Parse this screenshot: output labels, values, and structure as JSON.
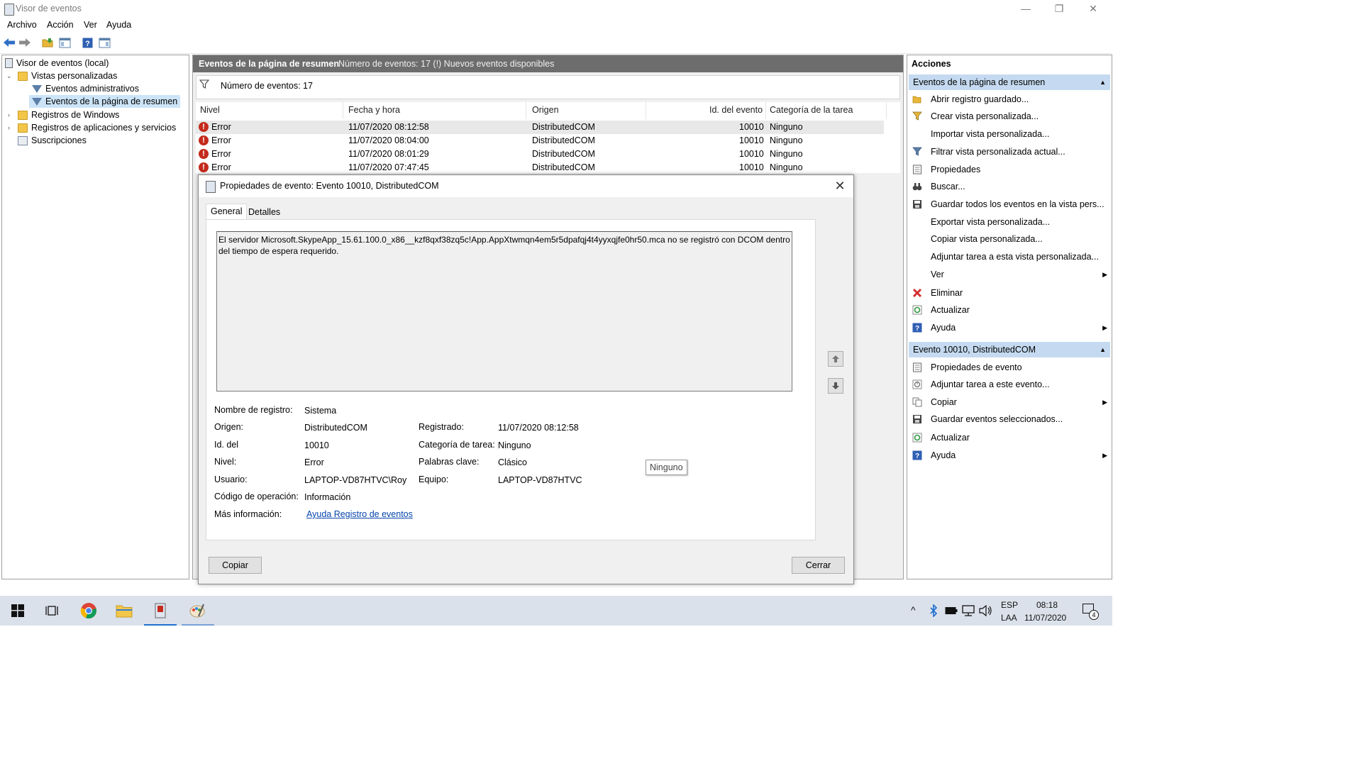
{
  "window": {
    "title": "Visor de eventos",
    "controls": {
      "minimize": "—",
      "restore": "❐",
      "close": "✕"
    }
  },
  "menu": [
    "Archivo",
    "Acción",
    "Ver",
    "Ayuda"
  ],
  "tree": {
    "items": [
      {
        "label": "Visor de eventos (local)"
      },
      {
        "label": "Vistas personalizadas"
      },
      {
        "label": "Eventos administrativos"
      },
      {
        "label": "Eventos de la página de resumen"
      },
      {
        "label": "Registros de Windows"
      },
      {
        "label": "Registros de aplicaciones y servicios"
      },
      {
        "label": "Suscripciones"
      }
    ]
  },
  "center": {
    "header_title": "Eventos de la página de resumen",
    "header_info": "Número de eventos: 17 (!) Nuevos eventos disponibles",
    "filter_text": "Número de eventos: 17",
    "columns": [
      "Nivel",
      "Fecha y hora",
      "Origen",
      "Id. del evento",
      "Categoría de la tarea"
    ],
    "rows": [
      {
        "level": "Error",
        "datetime": "11/07/2020 08:12:58",
        "source": "DistributedCOM",
        "id": "10010",
        "category": "Ninguno"
      },
      {
        "level": "Error",
        "datetime": "11/07/2020 08:04:00",
        "source": "DistributedCOM",
        "id": "10010",
        "category": "Ninguno"
      },
      {
        "level": "Error",
        "datetime": "11/07/2020 08:01:29",
        "source": "DistributedCOM",
        "id": "10010",
        "category": "Ninguno"
      },
      {
        "level": "Error",
        "datetime": "11/07/2020 07:47:45",
        "source": "DistributedCOM",
        "id": "10010",
        "category": "Ninguno"
      }
    ]
  },
  "dialog": {
    "title": "Propiedades de evento: Evento 10010, DistributedCOM",
    "tabs": [
      "General",
      "Detalles"
    ],
    "description": "El servidor Microsoft.SkypeApp_15.61.100.0_x86__kzf8qxf38zq5c!App.AppXtwmqn4em5r5dpafqj4t4yyxqjfe0hr50.mca no se registró con DCOM dentro del tiempo de espera requerido.",
    "fields": {
      "log_name_label": "Nombre de registro:",
      "log_name": "Sistema",
      "source_label": "Origen:",
      "source": "DistributedCOM",
      "logged_label": "Registrado:",
      "logged": "11/07/2020 08:12:58",
      "event_id_label": "Id. del",
      "event_id": "10010",
      "task_cat_label": "Categoría de tarea:",
      "task_cat": "Ninguno",
      "level_label": "Nivel:",
      "level": "Error",
      "keywords_label": "Palabras clave:",
      "keywords": "Clásico",
      "user_label": "Usuario:",
      "user": "LAPTOP-VD87HTVC\\Roy",
      "computer_label": "Equipo:",
      "computer": "LAPTOP-VD87HTVC",
      "opcode_label": "Código de operación:",
      "opcode": "Información",
      "more_info_label": "Más información:",
      "more_info_link": "Ayuda Registro de eventos"
    },
    "tooltip": "Ninguno",
    "copy_button": "Copiar",
    "close_button": "Cerrar"
  },
  "actions": {
    "title": "Acciones",
    "section1": {
      "title": "Eventos de la página de resumen",
      "items": [
        {
          "label": "Abrir registro guardado...",
          "icon": "folder-open-icon"
        },
        {
          "label": "Crear vista personalizada...",
          "icon": "filter-create-icon"
        },
        {
          "label": "Importar vista personalizada...",
          "icon": ""
        },
        {
          "label": "Filtrar vista personalizada actual...",
          "icon": "filter-icon"
        },
        {
          "label": "Propiedades",
          "icon": "properties-icon"
        },
        {
          "label": "Buscar...",
          "icon": "binoculars-icon"
        },
        {
          "label": "Guardar todos los eventos en la vista pers...",
          "icon": "save-icon"
        },
        {
          "label": "Exportar vista personalizada...",
          "icon": ""
        },
        {
          "label": "Copiar vista personalizada...",
          "icon": ""
        },
        {
          "label": "Adjuntar tarea a esta vista personalizada...",
          "icon": ""
        },
        {
          "label": "Ver",
          "icon": "",
          "submenu": true
        },
        {
          "label": "Eliminar",
          "icon": "delete-icon"
        },
        {
          "label": "Actualizar",
          "icon": "refresh-icon"
        },
        {
          "label": "Ayuda",
          "icon": "help-icon",
          "submenu": true
        }
      ]
    },
    "section2": {
      "title": "Evento 10010, DistributedCOM",
      "items": [
        {
          "label": "Propiedades de evento",
          "icon": "properties-icon"
        },
        {
          "label": "Adjuntar tarea a este evento...",
          "icon": "task-icon"
        },
        {
          "label": "Copiar",
          "icon": "copy-icon",
          "submenu": true
        },
        {
          "label": "Guardar eventos seleccionados...",
          "icon": "save-icon"
        },
        {
          "label": "Actualizar",
          "icon": "refresh-icon"
        },
        {
          "label": "Ayuda",
          "icon": "help-icon",
          "submenu": true
        }
      ]
    }
  },
  "taskbar": {
    "lang_top": "ESP",
    "lang_bottom": "LAA",
    "time": "08:18",
    "date": "11/07/2020",
    "notification_count": "4"
  },
  "colors": {
    "accent": "#1e6fd0",
    "section_header": "#c5daf0",
    "error": "#c42b1c",
    "link": "#0645ad"
  }
}
